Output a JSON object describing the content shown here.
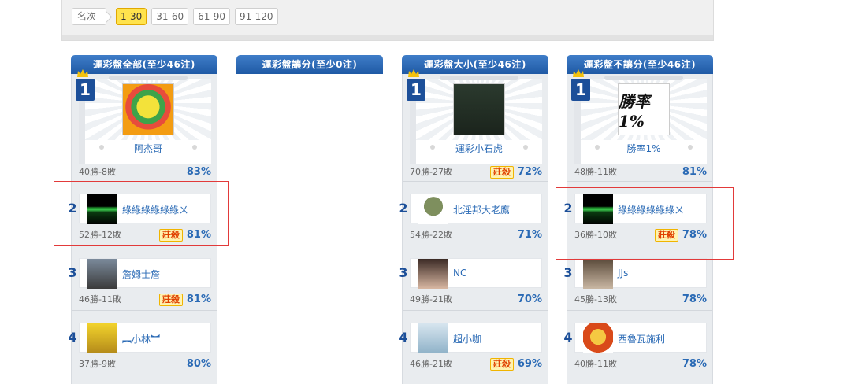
{
  "filter": {
    "label": "名次",
    "options": [
      "1-30",
      "31-60",
      "61-90",
      "91-120"
    ],
    "active": "1-30"
  },
  "columns": [
    {
      "title": "運彩盤全部(至少46注)",
      "first": {
        "name": "阿杰哥",
        "wl": "40勝-8敗",
        "pct": "83%",
        "badge": ""
      },
      "rows": [
        {
          "rank": "2",
          "name": "綠綠綠綠綠綠ㄨ",
          "wl": "52勝-12敗",
          "pct": "81%",
          "badge": "莊殺"
        },
        {
          "rank": "3",
          "name": "詹姆士詹",
          "wl": "46勝-11敗",
          "pct": "81%",
          "badge": "莊殺"
        },
        {
          "rank": "4",
          "name": "︻小林︼",
          "wl": "37勝-9敗",
          "pct": "80%",
          "badge": ""
        }
      ]
    },
    {
      "title": "運彩盤讓分(至少0注)"
    },
    {
      "title": "運彩盤大小(至少46注)",
      "first": {
        "name": "運彩小石虎",
        "wl": "70勝-27敗",
        "pct": "72%",
        "badge": "莊殺"
      },
      "rows": [
        {
          "rank": "2",
          "name": "北淫邦大老鷹",
          "wl": "54勝-22敗",
          "pct": "71%",
          "badge": ""
        },
        {
          "rank": "3",
          "name": "NC",
          "wl": "49勝-21敗",
          "pct": "70%",
          "badge": ""
        },
        {
          "rank": "4",
          "name": "超小咖",
          "wl": "46勝-21敗",
          "pct": "69%",
          "badge": "莊殺"
        }
      ]
    },
    {
      "title": "運彩盤不讓分(至少46注)",
      "first": {
        "name": "勝率1%",
        "avatar_text": "勝率 1%",
        "wl": "48勝-11敗",
        "pct": "81%",
        "badge": ""
      },
      "rows": [
        {
          "rank": "2",
          "name": "綠綠綠綠綠綠ㄨ",
          "wl": "36勝-10敗",
          "pct": "78%",
          "badge": "莊殺"
        },
        {
          "rank": "3",
          "name": "JJs",
          "wl": "45勝-13敗",
          "pct": "78%",
          "badge": ""
        },
        {
          "rank": "4",
          "name": "西魯瓦施利",
          "wl": "40勝-11敗",
          "pct": "78%",
          "badge": ""
        }
      ]
    }
  ],
  "colors": {
    "header_blue": "#1f5aa5",
    "link_blue": "#2a6ab5",
    "highlight_red": "#e23a3a",
    "badge_orange": "#e04000"
  }
}
